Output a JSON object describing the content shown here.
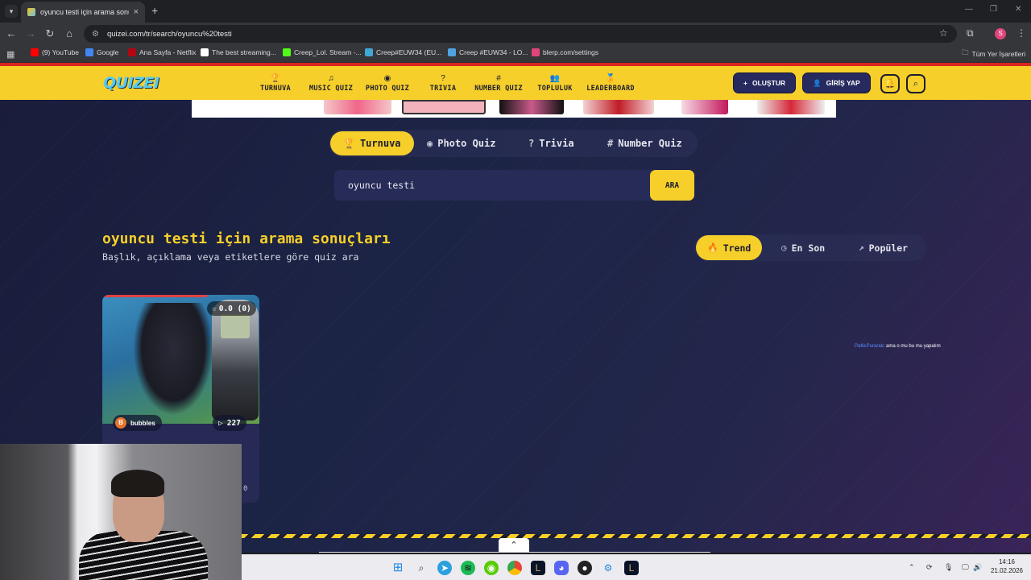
{
  "browser": {
    "tab_title": "oyuncu testi için arama sonuçla",
    "close_glyph": "×",
    "new_tab_glyph": "+",
    "url": "quizei.com/tr/search/oyuncu%20testi",
    "bookmarks": [
      {
        "label": "(9) YouTube",
        "color": "#ff0000"
      },
      {
        "label": "Google",
        "color": "#4285f4"
      },
      {
        "label": "Ana Sayfa - Netflix",
        "color": "#b20710"
      },
      {
        "label": "The best streaming...",
        "color": "#ffffff"
      },
      {
        "label": "Creep_Lol. Stream -...",
        "color": "#53fc18"
      },
      {
        "label": "Creep#EUW34 (EU...",
        "color": "#3fa8d6"
      },
      {
        "label": "Creep #EUW34 - LO...",
        "color": "#4fa3e0"
      },
      {
        "label": "blerp.com/settings",
        "color": "#e0457b"
      }
    ],
    "all_bookmarks_label": "Tüm Yer İşaretleri",
    "profile_initial": "S"
  },
  "site": {
    "logo": "QUIZEI",
    "nav": [
      {
        "label": "TURNUVA",
        "icon": "trophy-icon",
        "glyph": "🏆"
      },
      {
        "label": "MUSIC QUIZ",
        "icon": "music-icon",
        "glyph": "♫"
      },
      {
        "label": "PHOTO QUIZ",
        "icon": "camera-icon",
        "glyph": "◉"
      },
      {
        "label": "TRIVIA",
        "icon": "question-icon",
        "glyph": "?"
      },
      {
        "label": "NUMBER QUIZ",
        "icon": "hash-icon",
        "glyph": "#"
      },
      {
        "label": "TOPLULUK",
        "icon": "users-icon",
        "glyph": "👥"
      },
      {
        "label": "LEADERBOARD",
        "icon": "medal-icon",
        "glyph": "🏅"
      }
    ],
    "create_label": "OLUŞTUR",
    "login_label": "GİRİŞ YAP",
    "quiz_tabs": [
      {
        "label": "Turnuva",
        "icon": "trophy-icon",
        "glyph": "🏆",
        "active": true
      },
      {
        "label": "Photo Quiz",
        "icon": "camera-icon",
        "glyph": "◉",
        "active": false
      },
      {
        "label": "Trivia",
        "icon": "question-icon",
        "glyph": "?",
        "active": false
      },
      {
        "label": "Number Quiz",
        "icon": "hash-icon",
        "glyph": "#",
        "active": false
      }
    ],
    "search_value": "oyuncu testi",
    "search_button": "ARA",
    "results_title": "oyuncu testi için arama sonuçları",
    "results_subtitle": "Başlık, açıklama veya etiketlere göre quiz ara",
    "sorts": [
      {
        "label": "Trend",
        "icon": "flame-icon",
        "glyph": "🔥",
        "active": true
      },
      {
        "label": "En Son",
        "icon": "clock-icon",
        "glyph": "◷",
        "active": false
      },
      {
        "label": "Popüler",
        "icon": "trending-icon",
        "glyph": "↗",
        "active": false
      }
    ],
    "card": {
      "rating": "0.0 (0)",
      "author_initial": "B",
      "author": "bubbles",
      "plays": "227",
      "extra_count": "0"
    },
    "chat": {
      "user": "PatlicPurarak",
      "message": ": ama o mu bu mu yapalım"
    }
  },
  "taskbar": {
    "time": "14:16",
    "date": "21.02.2026"
  }
}
